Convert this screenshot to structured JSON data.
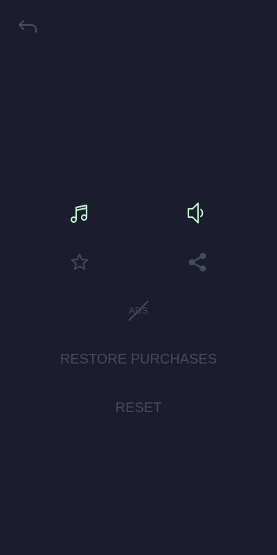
{
  "colors": {
    "background": "#1b1d2e",
    "active_icon": "#b8f2c7",
    "muted": "#464a5d",
    "back_arrow": "#4c5066"
  },
  "top_bar": {
    "back_icon": "undo-arrow-icon"
  },
  "settings_icons": {
    "music": {
      "icon": "music-note-icon",
      "state": "on"
    },
    "sound": {
      "icon": "speaker-icon",
      "state": "on"
    },
    "rate": {
      "icon": "star-icon"
    },
    "share": {
      "icon": "share-icon"
    }
  },
  "no_ads": {
    "label": "ADS",
    "icon": "no-ads-icon"
  },
  "buttons": {
    "restore_purchases": "RESTORE PURCHASES",
    "reset": "RESET"
  }
}
